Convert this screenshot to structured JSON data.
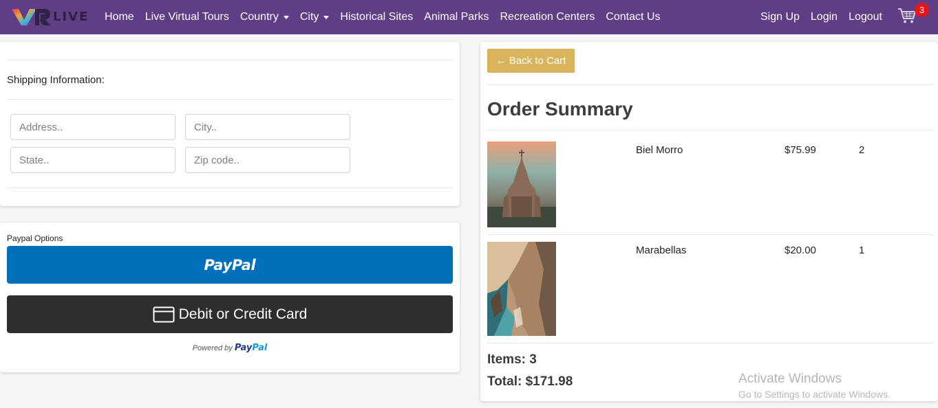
{
  "navbar": {
    "logo_text": "LIVE",
    "links": [
      {
        "label": "Home"
      },
      {
        "label": "Live Virtual Tours"
      },
      {
        "label": "Country"
      },
      {
        "label": "City"
      },
      {
        "label": "Historical Sites"
      },
      {
        "label": "Animal Parks"
      },
      {
        "label": "Recreation Centers"
      },
      {
        "label": "Contact Us"
      }
    ],
    "right_links": [
      {
        "label": "Sign Up"
      },
      {
        "label": "Login"
      },
      {
        "label": "Logout"
      }
    ],
    "cart_count": "3",
    "background": "#5f3e86"
  },
  "shipping": {
    "title": "Shipping Information:",
    "fields": {
      "address": {
        "placeholder": "Address..",
        "value": ""
      },
      "city": {
        "placeholder": "City..",
        "value": ""
      },
      "state": {
        "placeholder": "State..",
        "value": ""
      },
      "zip": {
        "placeholder": "Zip code..",
        "value": ""
      }
    }
  },
  "payment": {
    "label": "Paypal Options",
    "paypal_button": "PayPal",
    "card_button": "Debit or Credit Card",
    "powered_prefix": "Powered by",
    "powered_pay": "Pay",
    "powered_pal": "Pal",
    "paypal_color": "#0070ba",
    "card_color": "#2c2e2f"
  },
  "summary": {
    "back_button": "← Back to Cart",
    "title": "Order Summary",
    "items": [
      {
        "name": "Biel Morro",
        "price": "$75.99",
        "qty": "2",
        "image": "cathedral-photo"
      },
      {
        "name": "Marabellas",
        "price": "$20.00",
        "qty": "1",
        "image": "coastal-cliff-photo"
      }
    ],
    "items_total": "Items: 3",
    "order_total": "Total: $171.98",
    "back_color": "#d8b45c"
  },
  "watermark": {
    "line1": "Activate Windows",
    "line2": "Go to Settings to activate Windows."
  }
}
